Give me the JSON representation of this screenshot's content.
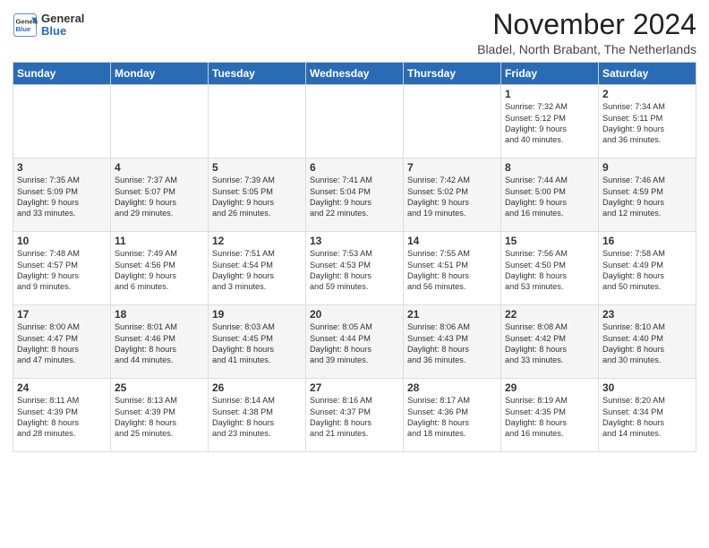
{
  "logo": {
    "line1": "General",
    "line2": "Blue"
  },
  "title": "November 2024",
  "subtitle": "Bladel, North Brabant, The Netherlands",
  "weekdays": [
    "Sunday",
    "Monday",
    "Tuesday",
    "Wednesday",
    "Thursday",
    "Friday",
    "Saturday"
  ],
  "weeks": [
    [
      {
        "day": "",
        "detail": ""
      },
      {
        "day": "",
        "detail": ""
      },
      {
        "day": "",
        "detail": ""
      },
      {
        "day": "",
        "detail": ""
      },
      {
        "day": "",
        "detail": ""
      },
      {
        "day": "1",
        "detail": "Sunrise: 7:32 AM\nSunset: 5:12 PM\nDaylight: 9 hours\nand 40 minutes."
      },
      {
        "day": "2",
        "detail": "Sunrise: 7:34 AM\nSunset: 5:11 PM\nDaylight: 9 hours\nand 36 minutes."
      }
    ],
    [
      {
        "day": "3",
        "detail": "Sunrise: 7:35 AM\nSunset: 5:09 PM\nDaylight: 9 hours\nand 33 minutes."
      },
      {
        "day": "4",
        "detail": "Sunrise: 7:37 AM\nSunset: 5:07 PM\nDaylight: 9 hours\nand 29 minutes."
      },
      {
        "day": "5",
        "detail": "Sunrise: 7:39 AM\nSunset: 5:05 PM\nDaylight: 9 hours\nand 26 minutes."
      },
      {
        "day": "6",
        "detail": "Sunrise: 7:41 AM\nSunset: 5:04 PM\nDaylight: 9 hours\nand 22 minutes."
      },
      {
        "day": "7",
        "detail": "Sunrise: 7:42 AM\nSunset: 5:02 PM\nDaylight: 9 hours\nand 19 minutes."
      },
      {
        "day": "8",
        "detail": "Sunrise: 7:44 AM\nSunset: 5:00 PM\nDaylight: 9 hours\nand 16 minutes."
      },
      {
        "day": "9",
        "detail": "Sunrise: 7:46 AM\nSunset: 4:59 PM\nDaylight: 9 hours\nand 12 minutes."
      }
    ],
    [
      {
        "day": "10",
        "detail": "Sunrise: 7:48 AM\nSunset: 4:57 PM\nDaylight: 9 hours\nand 9 minutes."
      },
      {
        "day": "11",
        "detail": "Sunrise: 7:49 AM\nSunset: 4:56 PM\nDaylight: 9 hours\nand 6 minutes."
      },
      {
        "day": "12",
        "detail": "Sunrise: 7:51 AM\nSunset: 4:54 PM\nDaylight: 9 hours\nand 3 minutes."
      },
      {
        "day": "13",
        "detail": "Sunrise: 7:53 AM\nSunset: 4:53 PM\nDaylight: 8 hours\nand 59 minutes."
      },
      {
        "day": "14",
        "detail": "Sunrise: 7:55 AM\nSunset: 4:51 PM\nDaylight: 8 hours\nand 56 minutes."
      },
      {
        "day": "15",
        "detail": "Sunrise: 7:56 AM\nSunset: 4:50 PM\nDaylight: 8 hours\nand 53 minutes."
      },
      {
        "day": "16",
        "detail": "Sunrise: 7:58 AM\nSunset: 4:49 PM\nDaylight: 8 hours\nand 50 minutes."
      }
    ],
    [
      {
        "day": "17",
        "detail": "Sunrise: 8:00 AM\nSunset: 4:47 PM\nDaylight: 8 hours\nand 47 minutes."
      },
      {
        "day": "18",
        "detail": "Sunrise: 8:01 AM\nSunset: 4:46 PM\nDaylight: 8 hours\nand 44 minutes."
      },
      {
        "day": "19",
        "detail": "Sunrise: 8:03 AM\nSunset: 4:45 PM\nDaylight: 8 hours\nand 41 minutes."
      },
      {
        "day": "20",
        "detail": "Sunrise: 8:05 AM\nSunset: 4:44 PM\nDaylight: 8 hours\nand 39 minutes."
      },
      {
        "day": "21",
        "detail": "Sunrise: 8:06 AM\nSunset: 4:43 PM\nDaylight: 8 hours\nand 36 minutes."
      },
      {
        "day": "22",
        "detail": "Sunrise: 8:08 AM\nSunset: 4:42 PM\nDaylight: 8 hours\nand 33 minutes."
      },
      {
        "day": "23",
        "detail": "Sunrise: 8:10 AM\nSunset: 4:40 PM\nDaylight: 8 hours\nand 30 minutes."
      }
    ],
    [
      {
        "day": "24",
        "detail": "Sunrise: 8:11 AM\nSunset: 4:39 PM\nDaylight: 8 hours\nand 28 minutes."
      },
      {
        "day": "25",
        "detail": "Sunrise: 8:13 AM\nSunset: 4:39 PM\nDaylight: 8 hours\nand 25 minutes."
      },
      {
        "day": "26",
        "detail": "Sunrise: 8:14 AM\nSunset: 4:38 PM\nDaylight: 8 hours\nand 23 minutes."
      },
      {
        "day": "27",
        "detail": "Sunrise: 8:16 AM\nSunset: 4:37 PM\nDaylight: 8 hours\nand 21 minutes."
      },
      {
        "day": "28",
        "detail": "Sunrise: 8:17 AM\nSunset: 4:36 PM\nDaylight: 8 hours\nand 18 minutes."
      },
      {
        "day": "29",
        "detail": "Sunrise: 8:19 AM\nSunset: 4:35 PM\nDaylight: 8 hours\nand 16 minutes."
      },
      {
        "day": "30",
        "detail": "Sunrise: 8:20 AM\nSunset: 4:34 PM\nDaylight: 8 hours\nand 14 minutes."
      }
    ]
  ]
}
